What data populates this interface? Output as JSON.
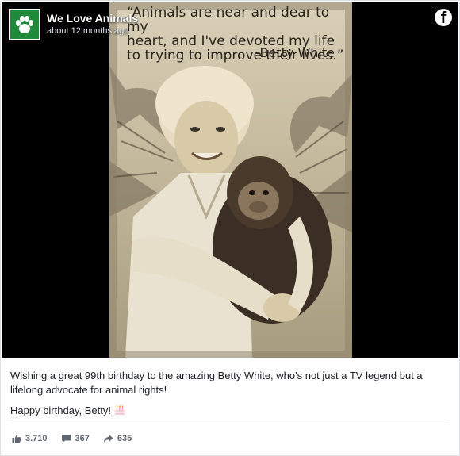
{
  "post": {
    "page_name": "We Love Animals",
    "timestamp": "about 12 months ago",
    "platform_icon": "facebook-icon",
    "avatar_icon": "paw-icon",
    "brand_color": "#1f8a3a",
    "image": {
      "quote_lines": [
        "“Animals are near and dear to my",
        "heart, and I've devoted my life",
        "to trying to improve their lives.”"
      ],
      "quote_author": "-Betty White"
    },
    "caption": [
      "Wishing a great 99th birthday to the amazing Betty White, who's not just a TV legend but a lifelong advocate for animal rights!",
      "Happy birthday, Betty!"
    ],
    "caption_emoji": "birthday-cake-icon",
    "stats": {
      "likes": "3.710",
      "comments": "367",
      "shares": "635"
    }
  }
}
